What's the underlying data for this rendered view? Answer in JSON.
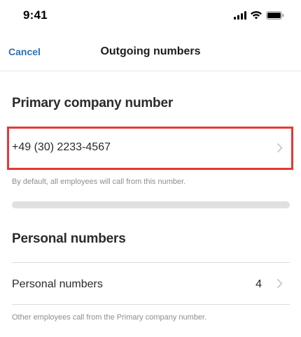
{
  "status_bar": {
    "time": "9:41",
    "icons": [
      "cellular-signal-icon",
      "wifi-icon",
      "battery-icon"
    ]
  },
  "nav": {
    "cancel_label": "Cancel",
    "title": "Outgoing numbers"
  },
  "primary_section": {
    "header": "Primary company number",
    "number": "+49 (30) 2233-4567",
    "caption": "By default, all employees will call from this number.",
    "progress_fraction": 0
  },
  "personal_section": {
    "header": "Personal numbers",
    "row_label": "Personal numbers",
    "row_count": "4",
    "caption": "Other employees call from the Primary company number."
  },
  "colors": {
    "accent": "#2f6fb7",
    "highlight_border": "#e53935",
    "caption_gray": "#8e8e93"
  }
}
